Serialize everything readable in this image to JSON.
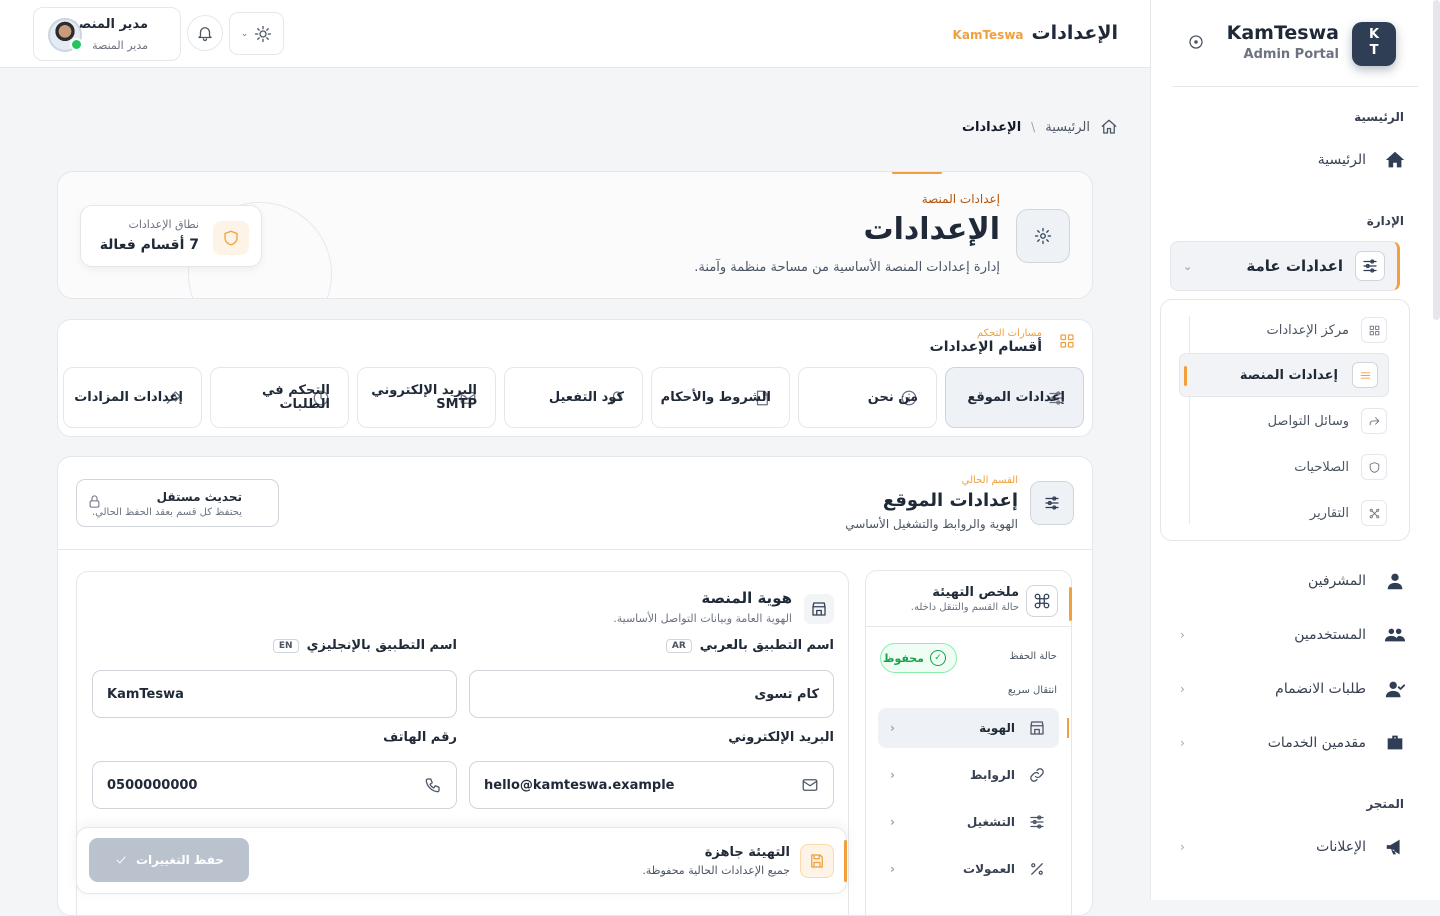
{
  "sidebar": {
    "brand_initials_top": "K",
    "brand_initials_bottom": "T",
    "brand_title": "KamTeswa",
    "brand_subtitle": "Admin Portal",
    "section_home": "الرئيسية",
    "item_home": "الرئيسية",
    "section_admin": "الإدارة",
    "active_group": "اعدادات عامة",
    "submenu": [
      {
        "label": "مركز الإعدادات",
        "icon": "grid-icon"
      },
      {
        "label": "إعدادات المنصة",
        "icon": "sliders-icon"
      },
      {
        "label": "وسائل التواصل",
        "icon": "share-icon"
      },
      {
        "label": "الصلاحيات",
        "icon": "shield-icon"
      },
      {
        "label": "التقارير",
        "icon": "chart-icon"
      }
    ],
    "item_supervisors": "المشرفين",
    "item_users": "المستخدمين",
    "item_join_requests": "طلبات الانضمام",
    "item_providers": "مقدمين الخدمات",
    "section_store": "المتجر",
    "item_ads": "الإعلانات"
  },
  "topbar": {
    "title": "الإعدادات",
    "brand": "KamTeswa",
    "user_name": "مدير المنصة",
    "user_role": "مدير المنصة"
  },
  "breadcrumb": {
    "home": "الرئيسية",
    "separator": "\\",
    "current": "الإعدادات"
  },
  "hero": {
    "kicker": "إعدادات المنصة",
    "title": "الإعدادات",
    "description": "إدارة إعدادات المنصة الأساسية من مساحة منظمة وآمنة.",
    "scope_label": "نطاق الإعدادات",
    "scope_value": "7 أقسام فعالة"
  },
  "sections": {
    "kicker": "مسارات التحكم",
    "title": "أقسام الإعدادات",
    "tabs": [
      {
        "label": "إعدادات الموقع",
        "icon": "sliders-icon"
      },
      {
        "label": "من نحن",
        "icon": "info-icon"
      },
      {
        "label": "الشروط والأحكام",
        "icon": "document-icon"
      },
      {
        "label": "كود التفعيل",
        "icon": "key-icon"
      },
      {
        "label": "البريد الإلكتروني SMTP",
        "icon": "mail-icon"
      },
      {
        "label": "التحكم في الطلبات",
        "icon": "clock-icon"
      },
      {
        "label": "إعدادات المزادات",
        "icon": "gavel-icon"
      }
    ]
  },
  "panel": {
    "kicker": "القسم الحالي",
    "title": "إعدادات الموقع",
    "description": "الهوية والروابط والتشغيل الأساسي",
    "independent_title": "تحديث مستقل",
    "independent_desc": "يحتفظ كل قسم بعقد الحفظ الحالي."
  },
  "summary": {
    "title": "ملخص التهيئة",
    "description": "حالة القسم والتنقل داخله.",
    "save_state_label": "حالة الحفظ",
    "save_state_value": "محفوظ",
    "quick_nav_label": "انتقال سريع",
    "nav": [
      {
        "label": "الهوية",
        "icon": "store-icon"
      },
      {
        "label": "الروابط",
        "icon": "link-icon"
      },
      {
        "label": "التشغيل",
        "icon": "sliders-icon"
      },
      {
        "label": "العمولات",
        "icon": "percent-icon"
      }
    ]
  },
  "identity": {
    "title": "هوية المنصة",
    "description": "الهوية العامة وبيانات التواصل الأساسية.",
    "app_name_ar_label": "اسم التطبيق بالعربي",
    "app_name_ar_tag": "AR",
    "app_name_ar_value": "كام تسوى",
    "app_name_en_label": "اسم التطبيق بالإنجليزي",
    "app_name_en_tag": "EN",
    "app_name_en_value": "KamTeswa",
    "email_label": "البريد الإلكتروني",
    "email_value": "hello@kamteswa.example",
    "phone_label": "رقم الهاتف",
    "phone_value": "0500000000"
  },
  "savebar": {
    "title": "التهيئة جاهزة",
    "description": "جميع الإعدادات الحالية محفوظة.",
    "button": "حفظ التغييرات"
  }
}
